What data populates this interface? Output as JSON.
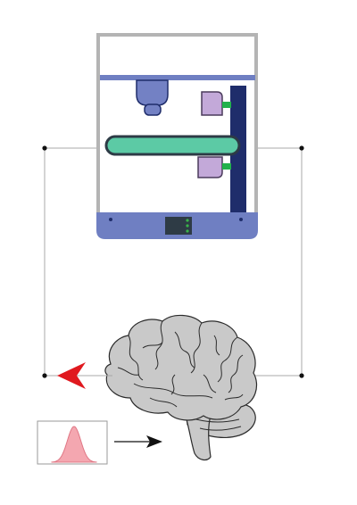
{
  "diagram": {
    "colors": {
      "frame": "#b4b4b4",
      "rail": "#6f7fc2",
      "base": "#6f7fc2",
      "column": "#1f2d6b",
      "bar": "#5ccaa5",
      "bar_stroke": "#2d3b46",
      "head": "#7381c4",
      "pad": "#c3a9d9",
      "connector": "#22b14c",
      "display": "#2e3b45",
      "led": "#39b54a",
      "wire": "#a8a8a8",
      "node": "#111111",
      "arrow_red": "#e0191f",
      "brain_fill": "#c9c9c9",
      "brain_stroke": "#2b2b2b",
      "curve_fill": "#f4a7b0",
      "curve_stroke": "#e07785",
      "arrow_black": "#111111"
    },
    "icons": {
      "machine": "lab-device-icon",
      "brain": "brain-icon",
      "distribution": "gaussian-distribution-icon",
      "feedback_arrow": "red-arrow-icon",
      "output_arrow": "black-arrow-icon"
    }
  }
}
